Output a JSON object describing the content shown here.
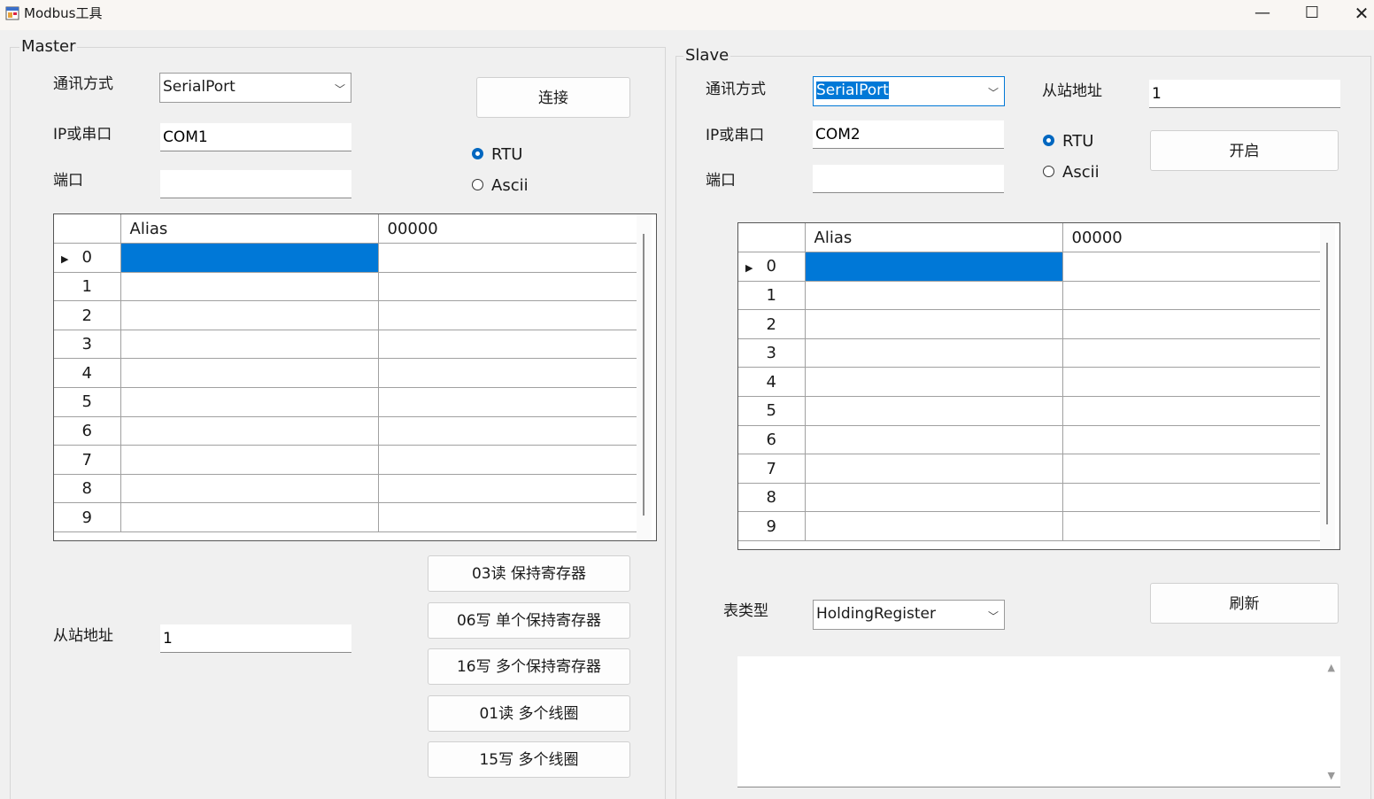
{
  "window": {
    "title": "Modbus工具",
    "minimize": "—",
    "maximize": "☐",
    "close": "✕",
    "icon": "app-window-icon"
  },
  "master": {
    "group_title": "Master",
    "comm_label": "通讯方式",
    "comm_value": "SerialPort",
    "ip_label": "IP或串口",
    "ip_value": "COM1",
    "port_label": "端口",
    "port_value": "",
    "connect_button": "连接",
    "radio_rtu": "RTU",
    "radio_ascii": "Ascii",
    "selected_mode": "RTU",
    "grid": {
      "headers": [
        "",
        "Alias",
        "00000"
      ],
      "rows": [
        "0",
        "1",
        "2",
        "3",
        "4",
        "5",
        "6",
        "7",
        "8",
        "9"
      ],
      "current_row": "0"
    },
    "slave_addr_label": "从站地址",
    "slave_addr_value": "1",
    "buttons": [
      "03读 保持寄存器",
      "06写 单个保持寄存器",
      "16写 多个保持寄存器",
      "01读 多个线圈",
      "15写 多个线圈"
    ]
  },
  "slave": {
    "group_title": "Slave",
    "comm_label": "通讯方式",
    "comm_value": "SerialPort",
    "ip_label": "IP或串口",
    "ip_value": "COM2",
    "port_label": "端口",
    "port_value": "",
    "slave_addr_label": "从站地址",
    "slave_addr_value": "1",
    "radio_rtu": "RTU",
    "radio_ascii": "Ascii",
    "selected_mode": "RTU",
    "open_button": "开启",
    "grid": {
      "headers": [
        "",
        "Alias",
        "00000"
      ],
      "rows": [
        "0",
        "1",
        "2",
        "3",
        "4",
        "5",
        "6",
        "7",
        "8",
        "9"
      ],
      "current_row": "0"
    },
    "table_type_label": "表类型",
    "table_type_value": "HoldingRegister",
    "refresh_button": "刷新",
    "log_text": ""
  },
  "colors": {
    "selection": "#0078d7",
    "radio_checked": "#0067c0"
  }
}
